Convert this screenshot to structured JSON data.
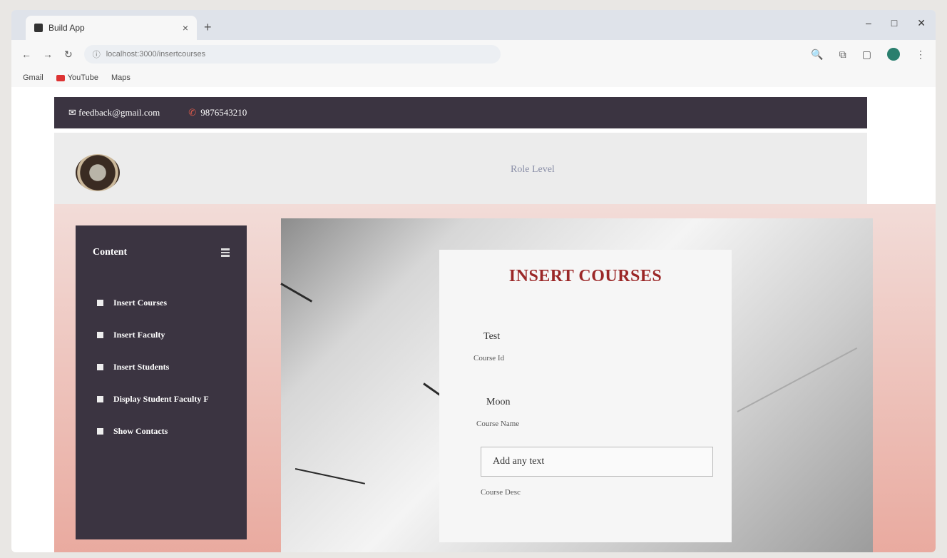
{
  "browser": {
    "tab_title": "Build App",
    "tab_close": "×",
    "new_tab": "+",
    "url": "localhost:3000/insertcourses",
    "window_controls": {
      "minimize": "–",
      "maximize": "□",
      "close": "✕"
    },
    "bookmarks": [
      "Gmail",
      "YouTube",
      "Maps"
    ]
  },
  "topbar": {
    "email": "feedback@gmail.com",
    "phone": "9876543210"
  },
  "header": {
    "center_text": "Role Level"
  },
  "sidebar": {
    "title": "Content",
    "items": [
      {
        "label": "Insert Courses"
      },
      {
        "label": "Insert Faculty"
      },
      {
        "label": "Insert Students"
      },
      {
        "label": "Display Student Faculty F"
      },
      {
        "label": "Show Contacts"
      }
    ]
  },
  "form": {
    "title": "INSERT COURSES",
    "course_id_value": "Test",
    "course_id_label": "Course Id",
    "course_name_value": "Moon",
    "course_name_label": "Course Name",
    "course_desc_value": "Add any text",
    "course_desc_label": "Course Desc"
  },
  "colors": {
    "topbar_bg": "#3b3441",
    "sidebar_bg": "#3b3441",
    "title_red": "#9b2727",
    "content_bg_top": "#f2dcd8",
    "content_bg_bottom": "#e9a99e"
  }
}
